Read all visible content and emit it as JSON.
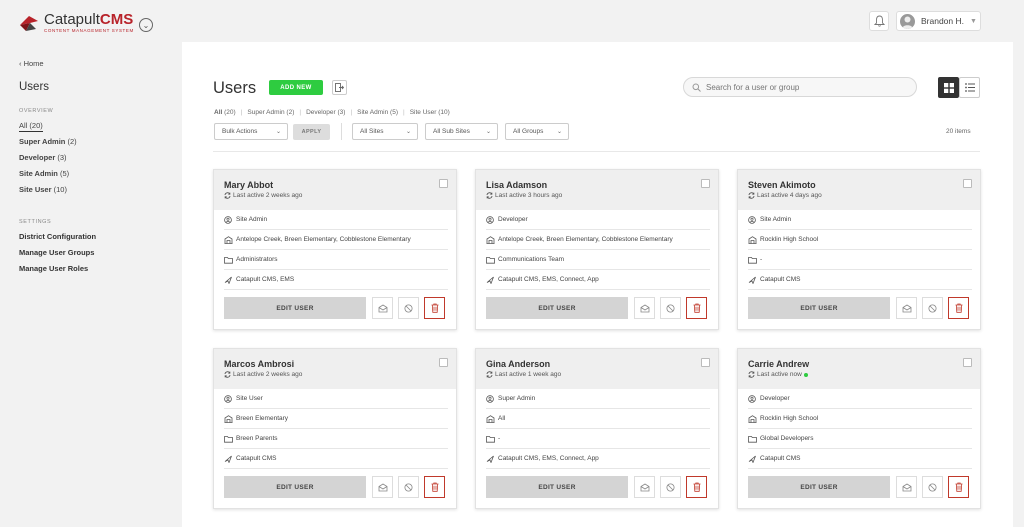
{
  "header": {
    "brand_prefix": "Catapult",
    "brand_suffix": "CMS",
    "brand_subtitle": "CONTENT MANAGEMENT SYSTEM",
    "user_name": "Brandon H.",
    "accent_color": "#b8232a"
  },
  "sidebar": {
    "back_label": "Home",
    "title": "Users",
    "overview_heading": "OVERVIEW",
    "overview_items": [
      {
        "label": "All (20)"
      },
      {
        "label": "Super Admin",
        "count": "(2)"
      },
      {
        "label": "Developer",
        "count": "(3)"
      },
      {
        "label": "Site Admin",
        "count": "(5)"
      },
      {
        "label": "Site User",
        "count": "(10)"
      }
    ],
    "settings_heading": "SETTINGS",
    "settings_items": [
      {
        "label": "District Configuration"
      },
      {
        "label": "Manage User Groups"
      },
      {
        "label": "Manage User Roles"
      }
    ]
  },
  "main": {
    "title": "Users",
    "add_label": "ADD NEW",
    "search_placeholder": "Search for a user or group",
    "tabs": [
      {
        "label": "All",
        "count": "(20)"
      },
      {
        "label": "Super Admin (2)"
      },
      {
        "label": "Developer (3)"
      },
      {
        "label": "Site Admin (5)"
      },
      {
        "label": "Site User (10)"
      }
    ],
    "bulk_actions": "Bulk Actions",
    "apply_label": "APPLY",
    "all_sites": "All Sites",
    "all_sub_sites": "All Sub Sites",
    "all_groups": "All Groups",
    "items_count": "20 items",
    "add_color": "#2ecc40"
  },
  "cards": [
    {
      "name": "Mary Abbot",
      "active": "Last active 2 weeks ago",
      "role": "Site Admin",
      "sites": "Antelope Creek, Breen Elementary, Cobblestone Elementary",
      "group": "Administrators",
      "apps": "Catapult CMS, EMS",
      "edit_label": "EDIT USER"
    },
    {
      "name": "Lisa Adamson",
      "active": "Last active 3 hours ago",
      "role": "Developer",
      "sites": "Antelope Creek, Breen Elementary, Cobblestone Elementary",
      "group": "Communications Team",
      "apps": "Catapult CMS, EMS, Connect, App",
      "edit_label": "EDIT USER"
    },
    {
      "name": "Steven Akimoto",
      "active": "Last active 4 days ago",
      "role": "Site Admin",
      "sites": "Rocklin High School",
      "group": "-",
      "apps": "Catapult CMS",
      "edit_label": "EDIT USER"
    },
    {
      "name": "Marcos Ambrosi",
      "active": "Last active 2 weeks ago",
      "role": "Site User",
      "sites": "Breen Elementary",
      "group": "Breen Parents",
      "apps": "Catapult CMS",
      "edit_label": "EDIT USER"
    },
    {
      "name": "Gina Anderson",
      "active": "Last active 1 week ago",
      "role": "Super Admin",
      "sites": "All",
      "group": "-",
      "apps": "Catapult CMS, EMS, Connect, App",
      "edit_label": "EDIT USER"
    },
    {
      "name": "Carrie Andrew",
      "active": "Last active now",
      "online": true,
      "role": "Developer",
      "sites": "Rocklin High School",
      "group": "Global Developers",
      "apps": "Catapult CMS",
      "edit_label": "EDIT USER"
    }
  ]
}
